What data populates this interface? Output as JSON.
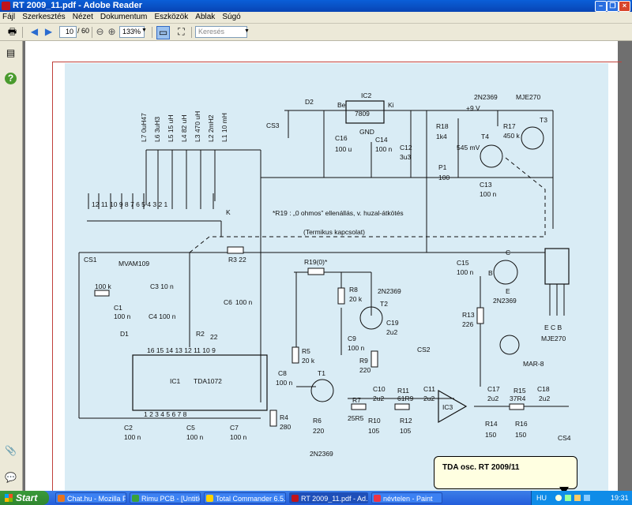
{
  "window": {
    "title": "RT 2009_11.pdf - Adobe Reader"
  },
  "menu": [
    "Fájl",
    "Szerkesztés",
    "Nézet",
    "Dokumentum",
    "Eszközök",
    "Ablak",
    "Súgó"
  ],
  "toolbar": {
    "page_current": "10",
    "page_total": "/ 60",
    "zoom": "133%",
    "search_placeholder": "Keresés"
  },
  "schematic": {
    "labels": {
      "ic2": "IC2",
      "v7809": "7809",
      "be": "Be",
      "ki": "Ki",
      "gnd": "GND",
      "d2": "D2",
      "cs3": "CS3",
      "c16": "C16",
      "c16v": "100 u",
      "c14": "C14",
      "c14v": "100 n",
      "c12": "C12",
      "c12v": "3u3",
      "q2n2369top": "2N2369",
      "mje270top": "MJE270",
      "plus9v": "+9 V",
      "r18": "R18",
      "r18v": "1k4",
      "r17": "R17",
      "r17v": "450 k",
      "t3": "T3",
      "t4": "T4",
      "v545": "545 mV",
      "p1": "P1",
      "p1v": "100",
      "c13": "C13",
      "c13v": "100 n",
      "l7": "L7  0uH47",
      "l6": "L6  3uH3",
      "l5": "L5  15 uH",
      "l4": "L4  82 uH",
      "l3": "L3  470 uH",
      "l2": "L2  2mH2",
      "l1": "L1  10 mH",
      "k": "K",
      "note1": "*R19 : „0 ohmos” ellenállás, v. huzal-átkötés",
      "note2": "(Termikus kapcsolat)",
      "cs1": "CS1",
      "mvam": "MVAM109",
      "r3": "R3  22",
      "r19": "R19(0)*",
      "c15": "C15",
      "c15v": "100 n",
      "r100k": "100 k",
      "c3": "C3  10 n",
      "c1": "C1",
      "c1v": "100 n",
      "c6": "C6",
      "c6v": "100 n",
      "c4": "C4  100 n",
      "d1": "D1",
      "r2": "R2",
      "r2v": "22",
      "r8": "R8",
      "r8v": "20 k",
      "t2lab": "2N2369",
      "t2": "T2",
      "c19": "C19",
      "c19v": "2u2",
      "c9": "C9",
      "c9v": "100 n",
      "cs2": "CS2",
      "r9": "R9",
      "r9v": "220",
      "r5": "R5",
      "r5v": "20 k",
      "r13": "R13",
      "r13v": "226",
      "ic1": "IC1",
      "tda": "TDA1072",
      "c8": "C8",
      "c8v": "100 n",
      "t1": "T1",
      "r7": "R7",
      "r7v": "25R5",
      "c10": "C10",
      "c10v": "2u2",
      "r11": "R11",
      "r11v": "61R9",
      "c11": "C11",
      "c11v": "2u2",
      "ic3": "IC3",
      "c17": "C17",
      "c17v": "2u2",
      "r15": "R15",
      "r15v": "37R4",
      "c18": "C18",
      "c18v": "2u2",
      "r4": "R4",
      "r4v": "280",
      "r6": "R6",
      "r6v": "220",
      "r10": "R10",
      "r10v": "105",
      "r12": "R12",
      "r12v": "105",
      "r14": "R14",
      "r14v": "150",
      "r16": "R16",
      "r16v": "150",
      "cs4": "CS4",
      "c2": "C2",
      "c2v": "100 n",
      "c5": "C5",
      "c5v": "100 n",
      "c7": "C7",
      "c7v": "100 n",
      "bottom2n": "2N2369",
      "mar8": "MAR-8",
      "ecb": "E  C  B",
      "mje270": "MJE270",
      "pkg_c": "C",
      "pkg_b": "B",
      "pkg_e": "E",
      "pkg_2n": "2N2369",
      "pins_top": "16  15  14  13  12  11  10   9",
      "pins_bot": "1    2    3    4    5    6    7    8",
      "sw": "12 11 10  9   8   7   6   5   4   3   2   1"
    }
  },
  "tooltip": "TDA osc. RT 2009/11",
  "taskbar": {
    "start": "Start",
    "tasks": [
      "Chat.hu - Mozilla Fire...",
      "Rimu PCB - [Untitled1]",
      "Total Commander 6.5...",
      "RT 2009_11.pdf - Ad...",
      "névtelen - Paint"
    ],
    "lang": "HU",
    "clock": "19:31"
  },
  "colors": {
    "titlebar": "#0a5fd8",
    "schematic_bg": "#d9ecf5",
    "taskbar": "#245edb"
  }
}
